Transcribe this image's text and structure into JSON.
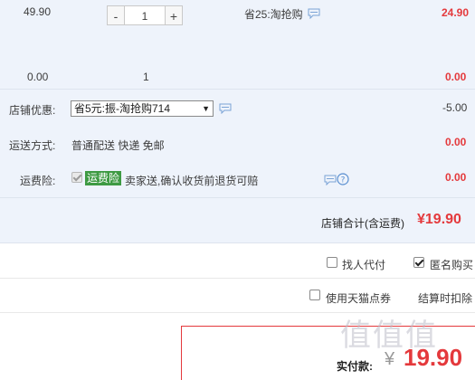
{
  "item_row": {
    "unit_price": "49.90",
    "qty_minus": "-",
    "qty_value": "1",
    "qty_plus": "+",
    "discount_text": "省25:淘抢购",
    "subtotal": "24.90"
  },
  "summary_row": {
    "unit_total": "0.00",
    "qty": "1",
    "subtotal": "0.00"
  },
  "shop_discount": {
    "label": "店铺优惠:",
    "selected": "省5元:振-淘抢购714",
    "value": "-5.00"
  },
  "shipping": {
    "label": "运送方式:",
    "text": "普通配送 快递 免邮",
    "value": "0.00"
  },
  "insurance": {
    "label": "运费险:",
    "badge": "运费险",
    "text": "卖家送,确认收货前退货可赔",
    "value": "0.00"
  },
  "shop_total": {
    "label": "店铺合计(含运费)",
    "value": "¥19.90"
  },
  "options": {
    "pay_for_me": "找人代付",
    "anonymous": "匿名购买",
    "use_points": "使用天猫点券",
    "deduct_note": "结算时扣除"
  },
  "payment": {
    "label": "实付款:",
    "currency": "¥",
    "amount": "19.90"
  },
  "watermark": "值值值",
  "colors": {
    "accent_red": "#e4393c",
    "row_bg": "#eef3fb",
    "badge_green": "#3e9a43"
  }
}
